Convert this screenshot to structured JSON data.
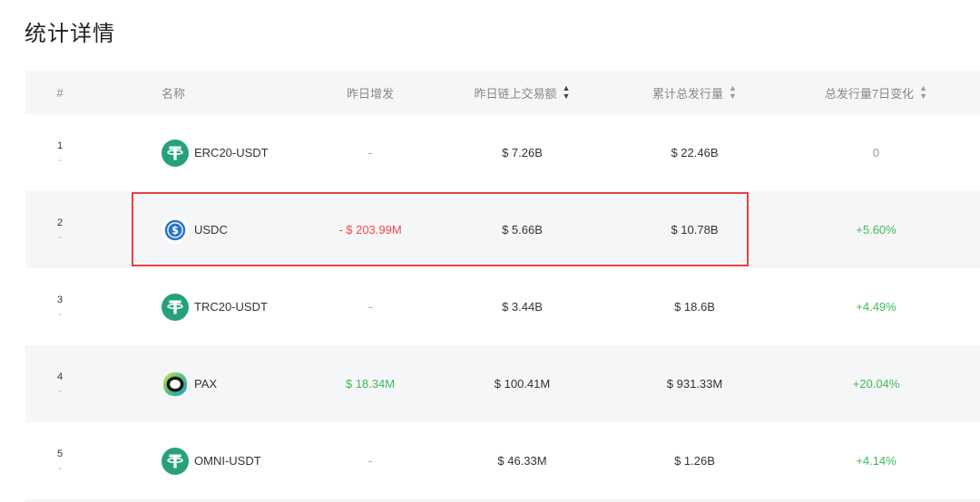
{
  "title": "统计详情",
  "columns": {
    "index": "#",
    "name": "名称",
    "increase": "昨日增发",
    "volume": "昨日链上交易额",
    "supply": "累计总发行量",
    "change7d": "总发行量7日变化"
  },
  "sort_icon": "◆",
  "rows": [
    {
      "index": "1",
      "sub": "-",
      "name": "ERC20-USDT",
      "icon": "tether-icon",
      "increase": "-",
      "volume": "$ 7.26B",
      "supply": "$ 22.46B",
      "change7d": "0"
    },
    {
      "index": "2",
      "sub": "-",
      "name": "USDC",
      "icon": "usdc-icon",
      "increase": "- $ 203.99M",
      "volume": "$ 5.66B",
      "supply": "$ 10.78B",
      "change7d": "+5.60%"
    },
    {
      "index": "3",
      "sub": "-",
      "name": "TRC20-USDT",
      "icon": "tether-icon",
      "increase": "-",
      "volume": "$ 3.44B",
      "supply": "$ 18.6B",
      "change7d": "+4.49%"
    },
    {
      "index": "4",
      "sub": "-",
      "name": "PAX",
      "icon": "pax-icon",
      "increase": "$ 18.34M",
      "volume": "$ 100.41M",
      "supply": "$ 931.33M",
      "change7d": "+20.04%"
    },
    {
      "index": "5",
      "sub": "-",
      "name": "OMNI-USDT",
      "icon": "tether-icon",
      "increase": "-",
      "volume": "$ 46.33M",
      "supply": "$ 1.26B",
      "change7d": "+4.14%"
    }
  ],
  "colors": {
    "tether": "#26a17b",
    "usdc": "#2775ca",
    "red": "#f04a48",
    "green": "#41b95a",
    "highlight": "#e8413c"
  }
}
